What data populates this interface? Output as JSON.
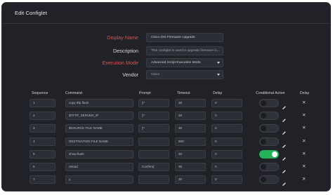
{
  "window": {
    "title": "Edit Configlet"
  },
  "form": {
    "display_name": {
      "label": "Display Name",
      "value": "Cisco IOS Firmware Upgrade"
    },
    "description": {
      "label": "Description",
      "placeholder": "This configlet is used to upgrade firmware in..."
    },
    "execution_mode": {
      "label": "Execution Mode",
      "value": "Advanced Script Execution Mode"
    },
    "vendor": {
      "label": "Vendor",
      "value": "Cisco"
    }
  },
  "table": {
    "headers": {
      "sequence": "Sequence",
      "command": "Command",
      "prompt": "Prompt",
      "timeout": "Timeout",
      "delay": "Delay",
      "conditional_action": "Conditional Action",
      "delete": "Delay"
    },
    "rows": [
      {
        "sequence": "1",
        "command": "copy tftp flash",
        "prompt": "[?",
        "timeout": "30",
        "delay": "0",
        "conditional": false
      },
      {
        "sequence": "2",
        "command": "$TFTP_SERVER_IP",
        "prompt": "[?",
        "timeout": "30",
        "delay": "0",
        "conditional": false
      },
      {
        "sequence": "3",
        "command": "$SOURCE FILE NAME",
        "prompt": "[?",
        "timeout": "30",
        "delay": "0",
        "conditional": false
      },
      {
        "sequence": "4",
        "command": "DESTINATION FILE NAME",
        "prompt": "",
        "timeout": "500",
        "delay": "0",
        "conditional": false
      },
      {
        "sequence": "5",
        "command": "show flash",
        "prompt": "",
        "timeout": "30",
        "delay": "0",
        "conditional": true
      },
      {
        "sequence": "6",
        "command": "reload",
        "prompt": "Confirm]",
        "timeout": "30",
        "delay": "0",
        "conditional": false
      },
      {
        "sequence": "7",
        "command": "y",
        "prompt": "",
        "timeout": "30",
        "delay": "0",
        "conditional": false
      }
    ]
  },
  "icons": {
    "edit": "pencil-icon",
    "delete": "close-icon",
    "dropdown": "chevron-down-icon"
  },
  "colors": {
    "background": "#202227",
    "required_label": "#e0524f",
    "toggle_on": "#23b45a"
  }
}
